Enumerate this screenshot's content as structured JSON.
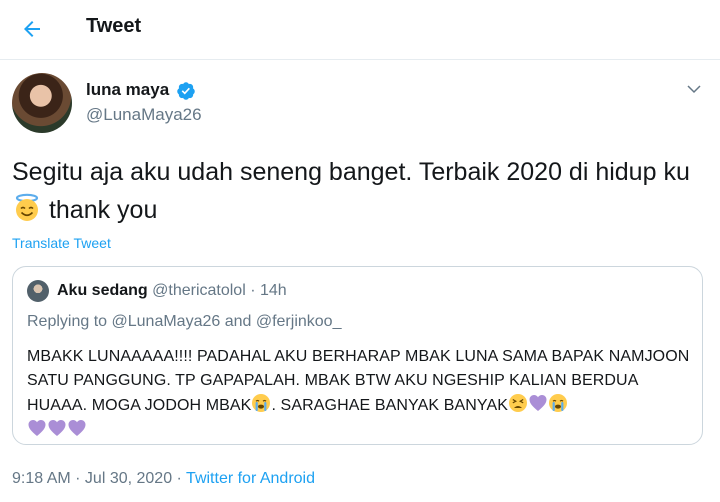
{
  "header": {
    "back_icon": "arrow-left-icon",
    "title": "Tweet",
    "accent": "#1da1f2"
  },
  "tweet": {
    "author_name": "luna maya",
    "verified_icon": "verified-badge-icon",
    "handle": "@LunaMaya26",
    "more_icon": "chevron-down-icon",
    "text_part1": "Segitu aja aku udah seneng banget. Terbaik 2020 di hidup ku",
    "emoji1": "smiling-face-with-halo-icon",
    "text_part2": " thank you",
    "translate_label": "Translate Tweet"
  },
  "quote": {
    "name": "Aku sedang",
    "handle": "@thericatolol",
    "separator": " · ",
    "time": "14h",
    "reply_prefix": "Replying to ",
    "reply_to": "@LunaMaya26 and @ferjinkoo_",
    "text_part1": "MBAKK LUNAAAAA!!!! PADAHAL AKU BERHARAP MBAK LUNA SAMA BAPAK NAMJOON SATU PANGGUNG. TP GAPAPALAH. MBAK BTW AKU NGESHIP KALIAN BERDUA HUAAA. MOGA JODOH MBAK",
    "emoji_crying": "loudly-crying-face-icon",
    "text_part2": ". SARAGHAE BANYAK BANYAK",
    "emoji_tired": "tired-face-icon",
    "emoji_heart": "purple-heart-icon"
  },
  "footer": {
    "time": "9:18 AM",
    "separator": " · ",
    "date": "Jul 30, 2020",
    "source": "Twitter for Android"
  }
}
